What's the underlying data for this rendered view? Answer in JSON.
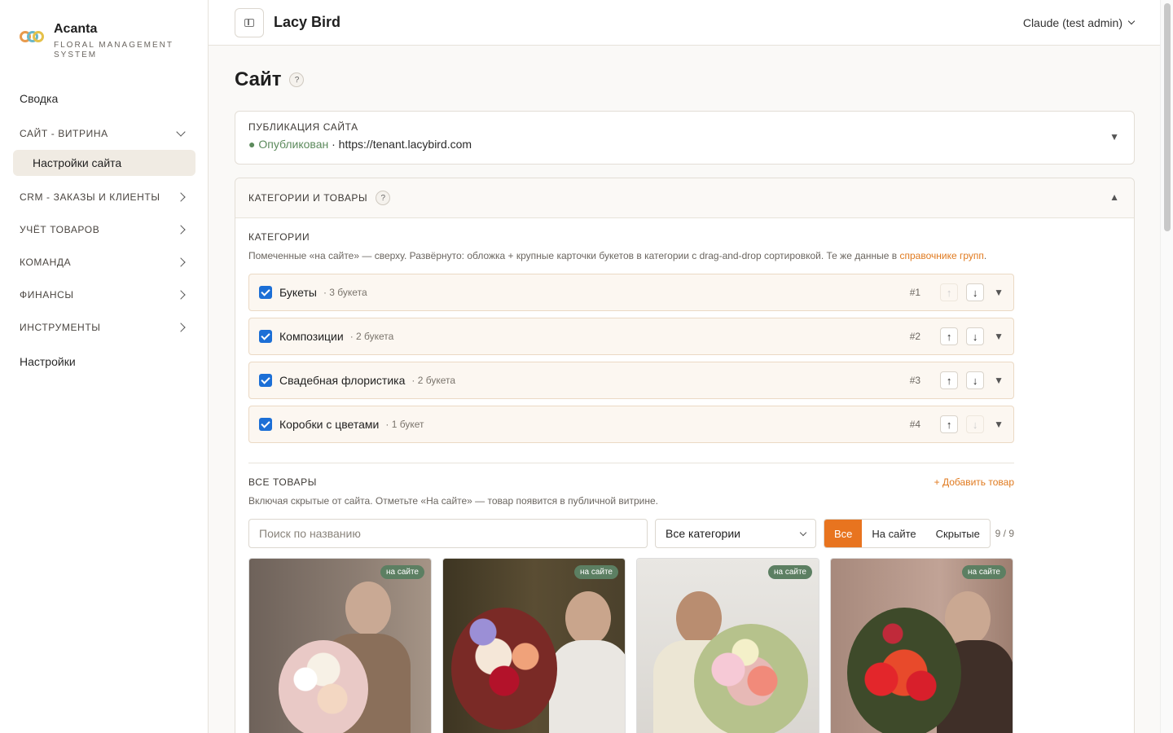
{
  "brand": {
    "name": "Acanta",
    "subtitle": "FLORAL MANAGEMENT SYSTEM"
  },
  "nav": {
    "summary": "Сводка",
    "site_section": "САЙТ - ВИТРИНА",
    "site_settings": "Настройки сайта",
    "crm": "CRM - ЗАКАЗЫ И КЛИЕНТЫ",
    "inventory": "УЧЁТ ТОВАРОВ",
    "team": "КОМАНДА",
    "finance": "ФИНАНСЫ",
    "tools": "ИНСТРУМЕНТЫ",
    "settings": "Настройки"
  },
  "header": {
    "title": "Lacy Bird",
    "user": "Claude (test admin)"
  },
  "page": {
    "title": "Сайт",
    "help": "?"
  },
  "publication": {
    "label": "ПУБЛИКАЦИЯ САЙТА",
    "status": "● Опубликован",
    "separator": " · ",
    "url": "https://tenant.lacybird.com",
    "caret": "▼"
  },
  "categories_card": {
    "label": "КАТЕГОРИИ И ТОВАРЫ",
    "help": "?",
    "caret": "▲",
    "sub_label": "КАТЕГОРИИ",
    "description": "Помеченные «на сайте» — сверху. Развёрнуто: обложка + крупные карточки букетов в категории с drag-and-drop сортировкой. Те же данные в ",
    "description_link": "справочнике групп",
    "description_end": ".",
    "rows": [
      {
        "name": "Букеты",
        "count": "· 3 букета",
        "pos": "#1",
        "up": "↑",
        "down": "↓",
        "caret": "▼"
      },
      {
        "name": "Композиции",
        "count": "· 2 букета",
        "pos": "#2",
        "up": "↑",
        "down": "↓",
        "caret": "▼"
      },
      {
        "name": "Свадебная флористика",
        "count": "· 2 букета",
        "pos": "#3",
        "up": "↑",
        "down": "↓",
        "caret": "▼"
      },
      {
        "name": "Коробки с цветами",
        "count": "· 1 букет",
        "pos": "#4",
        "up": "↑",
        "down": "↓",
        "caret": "▼"
      }
    ]
  },
  "products": {
    "label": "ВСЕ ТОВАРЫ",
    "add": "+ Добавить товар",
    "description": "Включая скрытые от сайта. Отметьте «На сайте» — товар появится в публичной витрине.",
    "search_placeholder": "Поиск по названию",
    "category_select": "Все категории",
    "filter_all": "Все",
    "filter_on_site": "На сайте",
    "filter_hidden": "Скрытые",
    "counter": "9 / 9",
    "badge": "на сайте",
    "colors": {
      "accent": "#e8741f",
      "badge": "#5c7f62",
      "link": "#e07a1f"
    }
  }
}
